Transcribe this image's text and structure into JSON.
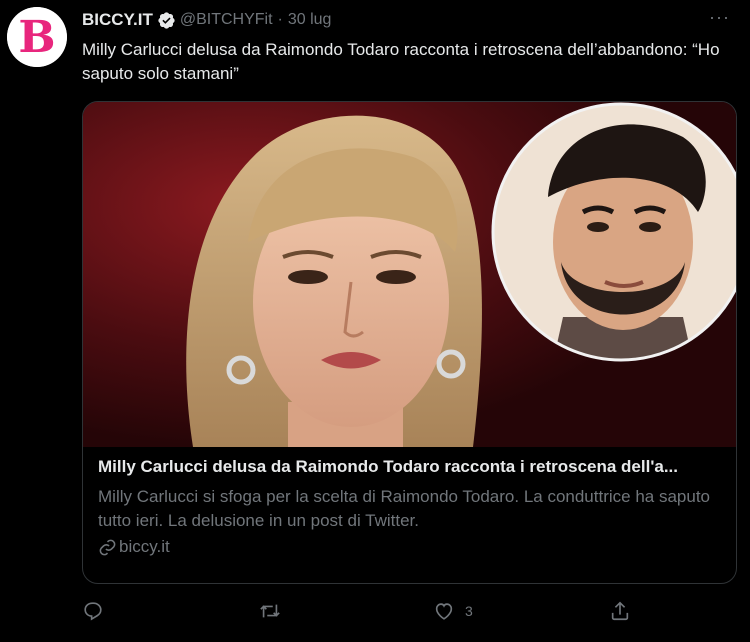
{
  "account": {
    "display_name": "BICCY.IT",
    "handle": "@BITCHYFit",
    "separator": "·",
    "date": "30 lug",
    "avatar_letter": "B",
    "avatar_color": "#e8267d",
    "verified_color": "#e7e9ea"
  },
  "tweet": {
    "text": "Milly Carlucci delusa da Raimondo Todaro racconta i retroscena dell’abbandono: “Ho saputo solo stamani”",
    "more_label": "···"
  },
  "card": {
    "title": "Milly Carlucci delusa da Raimondo Todaro racconta i retroscena dell'a...",
    "description": "Milly Carlucci si sfoga per la scelta di Raimondo Todaro. La conduttrice ha saputo tutto ieri. La delusione in un post di Twitter.",
    "domain": "biccy.it",
    "link_icon": "link-icon"
  },
  "actions": {
    "reply_icon": "reply-icon",
    "retweet_icon": "retweet-icon",
    "like_icon": "like-icon",
    "like_count": "3",
    "share_icon": "share-icon"
  },
  "colors": {
    "background": "#000000",
    "text_primary": "#e7e9ea",
    "text_secondary": "#71767b",
    "border": "#2f3336"
  }
}
